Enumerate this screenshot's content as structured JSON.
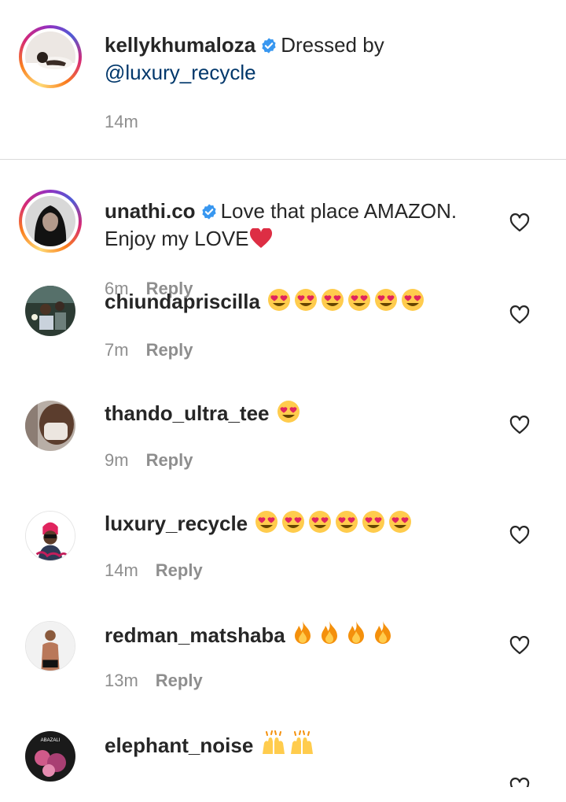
{
  "caption": {
    "username": "kellykhumaloza",
    "verified": true,
    "text": "Dressed by",
    "mention": "@luxury_recycle",
    "time": "14m"
  },
  "comments": [
    {
      "username": "unathi.co",
      "verified": true,
      "text": "Love that place AMAZON. Enjoy my LOVE",
      "emoji": [
        "red-heart"
      ],
      "time": "6m",
      "reply_label": "Reply",
      "story_ring": true
    },
    {
      "username": "chiundapriscilla",
      "verified": false,
      "text": "",
      "emoji": [
        "heart-eyes",
        "heart-eyes",
        "heart-eyes",
        "heart-eyes",
        "heart-eyes",
        "heart-eyes"
      ],
      "time": "7m",
      "reply_label": "Reply",
      "story_ring": false
    },
    {
      "username": "thando_ultra_tee",
      "verified": false,
      "text": "",
      "emoji": [
        "heart-eyes"
      ],
      "time": "9m",
      "reply_label": "Reply",
      "story_ring": false
    },
    {
      "username": "luxury_recycle",
      "verified": false,
      "text": "",
      "emoji": [
        "heart-eyes",
        "heart-eyes",
        "heart-eyes",
        "heart-eyes",
        "heart-eyes",
        "heart-eyes"
      ],
      "time": "14m",
      "reply_label": "Reply",
      "story_ring": false
    },
    {
      "username": "redman_matshaba",
      "verified": false,
      "text": "",
      "emoji": [
        "fire",
        "fire",
        "fire",
        "fire"
      ],
      "time": "13m",
      "reply_label": "Reply",
      "story_ring": false
    },
    {
      "username": "elephant_noise",
      "verified": false,
      "text": "",
      "emoji": [
        "raising-hands",
        "raising-hands"
      ],
      "time": "",
      "reply_label": "",
      "story_ring": false
    }
  ],
  "avatar_text": [
    "ABAZALI"
  ],
  "icons": {
    "verified": "verified-badge-icon",
    "like": "heart-outline-icon"
  },
  "colors": {
    "verified": "#3897f0",
    "mention": "#00376b",
    "meta": "#8e8e8e",
    "divider": "#dbdbdb"
  }
}
